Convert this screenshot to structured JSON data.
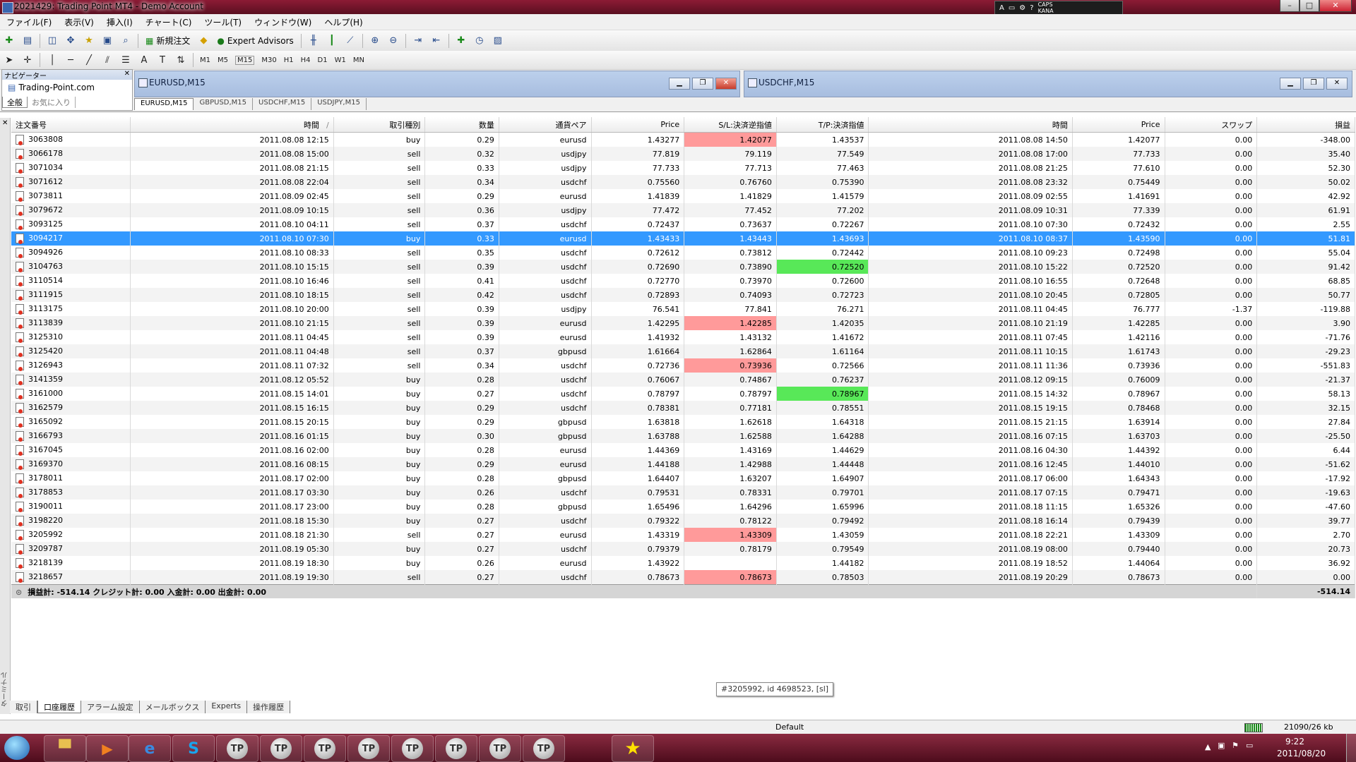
{
  "window": {
    "title": "2021429: Trading Point MT4 - Demo Account"
  },
  "langbar": {
    "caps": "CAPS",
    "kana": "KANA",
    "ime": "A"
  },
  "menu": [
    "ファイル(F)",
    "表示(V)",
    "挿入(I)",
    "チャート(C)",
    "ツール(T)",
    "ウィンドウ(W)",
    "ヘルプ(H)"
  ],
  "toolbar": {
    "new_order": "新規注文",
    "expert_advisors": "Expert Advisors"
  },
  "timeframes": [
    "M1",
    "M5",
    "M15",
    "M30",
    "H1",
    "H4",
    "D1",
    "W1",
    "MN"
  ],
  "navigator": {
    "title": "ナビゲーター",
    "item": "Trading-Point.com",
    "tab_all": "全般",
    "tab_fav": "お気に入り"
  },
  "charts": {
    "left_title": "EURUSD,M15",
    "right_title": "USDCHF,M15",
    "tabs": [
      "EURUSD,M15",
      "GBPUSD,M15",
      "USDCHF,M15",
      "USDJPY,M15"
    ]
  },
  "terminal": {
    "side_label": "ターミナル",
    "columns": [
      "注文番号",
      "時間",
      "取引種別",
      "数量",
      "通貨ペア",
      "Price",
      "S/L:決済逆指値",
      "T/P:決済指値",
      "時間",
      "Price",
      "スワップ",
      "損益"
    ],
    "sort_marker": "/",
    "rows": [
      {
        "id": "3063808",
        "open": "2011.08.08 12:15",
        "type": "buy",
        "lots": "0.29",
        "sym": "eurusd",
        "price": "1.43277",
        "sl": "1.42077",
        "tp": "1.43537",
        "close": "2011.08.08 14:50",
        "cprice": "1.42077",
        "swap": "0.00",
        "profit": "-348.00",
        "hl": "sl"
      },
      {
        "id": "3066178",
        "open": "2011.08.08 15:00",
        "type": "sell",
        "lots": "0.32",
        "sym": "usdjpy",
        "price": "77.819",
        "sl": "79.119",
        "tp": "77.549",
        "close": "2011.08.08 17:00",
        "cprice": "77.733",
        "swap": "0.00",
        "profit": "35.40"
      },
      {
        "id": "3071034",
        "open": "2011.08.08 21:15",
        "type": "sell",
        "lots": "0.33",
        "sym": "usdjpy",
        "price": "77.733",
        "sl": "77.713",
        "tp": "77.463",
        "close": "2011.08.08 21:25",
        "cprice": "77.610",
        "swap": "0.00",
        "profit": "52.30"
      },
      {
        "id": "3071612",
        "open": "2011.08.08 22:04",
        "type": "sell",
        "lots": "0.34",
        "sym": "usdchf",
        "price": "0.75560",
        "sl": "0.76760",
        "tp": "0.75390",
        "close": "2011.08.08 23:32",
        "cprice": "0.75449",
        "swap": "0.00",
        "profit": "50.02"
      },
      {
        "id": "3073811",
        "open": "2011.08.09 02:45",
        "type": "sell",
        "lots": "0.29",
        "sym": "eurusd",
        "price": "1.41839",
        "sl": "1.41829",
        "tp": "1.41579",
        "close": "2011.08.09 02:55",
        "cprice": "1.41691",
        "swap": "0.00",
        "profit": "42.92"
      },
      {
        "id": "3079672",
        "open": "2011.08.09 10:15",
        "type": "sell",
        "lots": "0.36",
        "sym": "usdjpy",
        "price": "77.472",
        "sl": "77.452",
        "tp": "77.202",
        "close": "2011.08.09 10:31",
        "cprice": "77.339",
        "swap": "0.00",
        "profit": "61.91"
      },
      {
        "id": "3093125",
        "open": "2011.08.10 04:11",
        "type": "sell",
        "lots": "0.37",
        "sym": "usdchf",
        "price": "0.72437",
        "sl": "0.73637",
        "tp": "0.72267",
        "close": "2011.08.10 07:30",
        "cprice": "0.72432",
        "swap": "0.00",
        "profit": "2.55"
      },
      {
        "id": "3094217",
        "open": "2011.08.10 07:30",
        "type": "buy",
        "lots": "0.33",
        "sym": "eurusd",
        "price": "1.43433",
        "sl": "1.43443",
        "tp": "1.43693",
        "close": "2011.08.10 08:37",
        "cprice": "1.43590",
        "swap": "0.00",
        "profit": "51.81",
        "selected": true
      },
      {
        "id": "3094926",
        "open": "2011.08.10 08:33",
        "type": "sell",
        "lots": "0.35",
        "sym": "usdchf",
        "price": "0.72612",
        "sl": "0.73812",
        "tp": "0.72442",
        "close": "2011.08.10 09:23",
        "cprice": "0.72498",
        "swap": "0.00",
        "profit": "55.04"
      },
      {
        "id": "3104763",
        "open": "2011.08.10 15:15",
        "type": "sell",
        "lots": "0.39",
        "sym": "usdchf",
        "price": "0.72690",
        "sl": "0.73890",
        "tp": "0.72520",
        "close": "2011.08.10 15:22",
        "cprice": "0.72520",
        "swap": "0.00",
        "profit": "91.42",
        "hl": "tp"
      },
      {
        "id": "3110514",
        "open": "2011.08.10 16:46",
        "type": "sell",
        "lots": "0.41",
        "sym": "usdchf",
        "price": "0.72770",
        "sl": "0.73970",
        "tp": "0.72600",
        "close": "2011.08.10 16:55",
        "cprice": "0.72648",
        "swap": "0.00",
        "profit": "68.85"
      },
      {
        "id": "3111915",
        "open": "2011.08.10 18:15",
        "type": "sell",
        "lots": "0.42",
        "sym": "usdchf",
        "price": "0.72893",
        "sl": "0.74093",
        "tp": "0.72723",
        "close": "2011.08.10 20:45",
        "cprice": "0.72805",
        "swap": "0.00",
        "profit": "50.77"
      },
      {
        "id": "3113175",
        "open": "2011.08.10 20:00",
        "type": "sell",
        "lots": "0.39",
        "sym": "usdjpy",
        "price": "76.541",
        "sl": "77.841",
        "tp": "76.271",
        "close": "2011.08.11 04:45",
        "cprice": "76.777",
        "swap": "-1.37",
        "profit": "-119.88"
      },
      {
        "id": "3113839",
        "open": "2011.08.10 21:15",
        "type": "sell",
        "lots": "0.39",
        "sym": "eurusd",
        "price": "1.42295",
        "sl": "1.42285",
        "tp": "1.42035",
        "close": "2011.08.10 21:19",
        "cprice": "1.42285",
        "swap": "0.00",
        "profit": "3.90",
        "hl": "sl"
      },
      {
        "id": "3125310",
        "open": "2011.08.11 04:45",
        "type": "sell",
        "lots": "0.39",
        "sym": "eurusd",
        "price": "1.41932",
        "sl": "1.43132",
        "tp": "1.41672",
        "close": "2011.08.11 07:45",
        "cprice": "1.42116",
        "swap": "0.00",
        "profit": "-71.76"
      },
      {
        "id": "3125420",
        "open": "2011.08.11 04:48",
        "type": "sell",
        "lots": "0.37",
        "sym": "gbpusd",
        "price": "1.61664",
        "sl": "1.62864",
        "tp": "1.61164",
        "close": "2011.08.11 10:15",
        "cprice": "1.61743",
        "swap": "0.00",
        "profit": "-29.23"
      },
      {
        "id": "3126943",
        "open": "2011.08.11 07:32",
        "type": "sell",
        "lots": "0.34",
        "sym": "usdchf",
        "price": "0.72736",
        "sl": "0.73936",
        "tp": "0.72566",
        "close": "2011.08.11 11:36",
        "cprice": "0.73936",
        "swap": "0.00",
        "profit": "-551.83",
        "hl": "sl"
      },
      {
        "id": "3141359",
        "open": "2011.08.12 05:52",
        "type": "buy",
        "lots": "0.28",
        "sym": "usdchf",
        "price": "0.76067",
        "sl": "0.74867",
        "tp": "0.76237",
        "close": "2011.08.12 09:15",
        "cprice": "0.76009",
        "swap": "0.00",
        "profit": "-21.37"
      },
      {
        "id": "3161000",
        "open": "2011.08.15 14:01",
        "type": "buy",
        "lots": "0.27",
        "sym": "usdchf",
        "price": "0.78797",
        "sl": "0.78797",
        "tp": "0.78967",
        "close": "2011.08.15 14:32",
        "cprice": "0.78967",
        "swap": "0.00",
        "profit": "58.13",
        "hl": "tp"
      },
      {
        "id": "3162579",
        "open": "2011.08.15 16:15",
        "type": "buy",
        "lots": "0.29",
        "sym": "usdchf",
        "price": "0.78381",
        "sl": "0.77181",
        "tp": "0.78551",
        "close": "2011.08.15 19:15",
        "cprice": "0.78468",
        "swap": "0.00",
        "profit": "32.15"
      },
      {
        "id": "3165092",
        "open": "2011.08.15 20:15",
        "type": "buy",
        "lots": "0.29",
        "sym": "gbpusd",
        "price": "1.63818",
        "sl": "1.62618",
        "tp": "1.64318",
        "close": "2011.08.15 21:15",
        "cprice": "1.63914",
        "swap": "0.00",
        "profit": "27.84"
      },
      {
        "id": "3166793",
        "open": "2011.08.16 01:15",
        "type": "buy",
        "lots": "0.30",
        "sym": "gbpusd",
        "price": "1.63788",
        "sl": "1.62588",
        "tp": "1.64288",
        "close": "2011.08.16 07:15",
        "cprice": "1.63703",
        "swap": "0.00",
        "profit": "-25.50"
      },
      {
        "id": "3167045",
        "open": "2011.08.16 02:00",
        "type": "buy",
        "lots": "0.28",
        "sym": "eurusd",
        "price": "1.44369",
        "sl": "1.43169",
        "tp": "1.44629",
        "close": "2011.08.16 04:30",
        "cprice": "1.44392",
        "swap": "0.00",
        "profit": "6.44"
      },
      {
        "id": "3169370",
        "open": "2011.08.16 08:15",
        "type": "buy",
        "lots": "0.29",
        "sym": "eurusd",
        "price": "1.44188",
        "sl": "1.42988",
        "tp": "1.44448",
        "close": "2011.08.16 12:45",
        "cprice": "1.44010",
        "swap": "0.00",
        "profit": "-51.62"
      },
      {
        "id": "3178011",
        "open": "2011.08.17 02:00",
        "type": "buy",
        "lots": "0.28",
        "sym": "gbpusd",
        "price": "1.64407",
        "sl": "1.63207",
        "tp": "1.64907",
        "close": "2011.08.17 06:00",
        "cprice": "1.64343",
        "swap": "0.00",
        "profit": "-17.92"
      },
      {
        "id": "3178853",
        "open": "2011.08.17 03:30",
        "type": "buy",
        "lots": "0.26",
        "sym": "usdchf",
        "price": "0.79531",
        "sl": "0.78331",
        "tp": "0.79701",
        "close": "2011.08.17 07:15",
        "cprice": "0.79471",
        "swap": "0.00",
        "profit": "-19.63"
      },
      {
        "id": "3190011",
        "open": "2011.08.17 23:00",
        "type": "buy",
        "lots": "0.28",
        "sym": "gbpusd",
        "price": "1.65496",
        "sl": "1.64296",
        "tp": "1.65996",
        "close": "2011.08.18 11:15",
        "cprice": "1.65326",
        "swap": "0.00",
        "profit": "-47.60"
      },
      {
        "id": "3198220",
        "open": "2011.08.18 15:30",
        "type": "buy",
        "lots": "0.27",
        "sym": "usdchf",
        "price": "0.79322",
        "sl": "0.78122",
        "tp": "0.79492",
        "close": "2011.08.18 16:14",
        "cprice": "0.79439",
        "swap": "0.00",
        "profit": "39.77"
      },
      {
        "id": "3205992",
        "open": "2011.08.18 21:30",
        "type": "sell",
        "lots": "0.27",
        "sym": "eurusd",
        "price": "1.43319",
        "sl": "1.43309",
        "tp": "1.43059",
        "close": "2011.08.18 22:21",
        "cprice": "1.43309",
        "swap": "0.00",
        "profit": "2.70",
        "hl": "sl"
      },
      {
        "id": "3209787",
        "open": "2011.08.19 05:30",
        "type": "buy",
        "lots": "0.27",
        "sym": "usdchf",
        "price": "0.79379",
        "sl": "0.78179",
        "tp": "0.79549",
        "close": "2011.08.19 08:00",
        "cprice": "0.79440",
        "swap": "0.00",
        "profit": "20.73"
      },
      {
        "id": "3218139",
        "open": "2011.08.19 18:30",
        "type": "buy",
        "lots": "0.26",
        "sym": "eurusd",
        "price": "1.43922",
        "sl": "",
        "tp": "1.44182",
        "close": "2011.08.19 18:52",
        "cprice": "1.44064",
        "swap": "0.00",
        "profit": "36.92"
      },
      {
        "id": "3218657",
        "open": "2011.08.19 19:30",
        "type": "sell",
        "lots": "0.27",
        "sym": "usdchf",
        "price": "0.78673",
        "sl": "0.78673",
        "tp": "0.78503",
        "close": "2011.08.19 20:29",
        "cprice": "0.78673",
        "swap": "0.00",
        "profit": "0.00",
        "hl": "sl"
      }
    ],
    "summary": {
      "text": "損益計: -514.14  クレジット計: 0.00  入金計: 0.00  出金計: 0.00",
      "total": "-514.14"
    },
    "tooltip": "#3205992, id 4698523, [sl]",
    "bottom_tabs": [
      "取引",
      "口座履歴",
      "アラーム設定",
      "メールボックス",
      "Experts",
      "操作履歴"
    ],
    "active_tab": 1
  },
  "status": {
    "profile": "Default",
    "traffic": "21090/26 kb"
  },
  "tray": {
    "time": "9:22",
    "date": "2011/08/20"
  },
  "colors": {
    "sl_hit": "#ff9a9a",
    "tp_hit": "#58e858",
    "selection": "#3399ff"
  }
}
